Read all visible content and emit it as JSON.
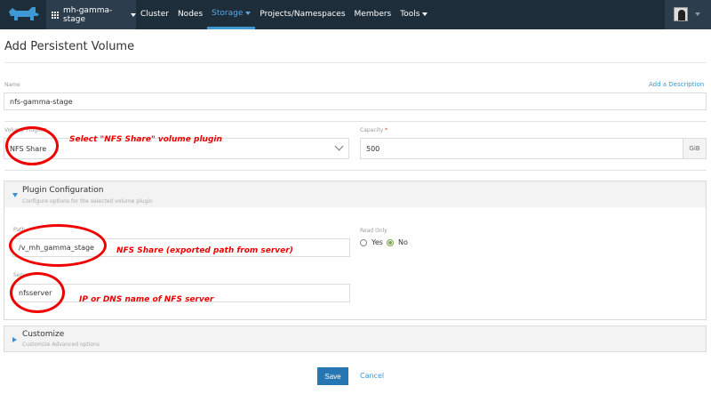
{
  "topbar": {
    "cluster": "mh-gamma-stage",
    "nav": [
      {
        "label": "Cluster",
        "caret": false
      },
      {
        "label": "Nodes",
        "caret": false
      },
      {
        "label": "Storage",
        "caret": true,
        "active": true
      },
      {
        "label": "Projects/Namespaces",
        "caret": false
      },
      {
        "label": "Members",
        "caret": false
      },
      {
        "label": "Tools",
        "caret": true
      }
    ]
  },
  "page": {
    "title": "Add Persistent Volume",
    "name_label": "Name",
    "add_description": "Add a Description",
    "name_value": "nfs-gamma-stage",
    "plugin_label": "Volume Plugin",
    "plugin_value": "NFS Share",
    "capacity_label": "Capacity",
    "capacity_value": "500",
    "capacity_unit": "GiB"
  },
  "plugin_config": {
    "title": "Plugin Configuration",
    "subtitle": "Configure options for the selected volume plugin",
    "path_label": "Path",
    "path_value": "/v_mh_gamma_stage",
    "server_label": "Server",
    "server_value": "nfsserver",
    "readonly_label": "Read Only",
    "yes": "Yes",
    "no": "No",
    "readonly_selected": "No"
  },
  "customize": {
    "title": "Customize",
    "subtitle": "Customize Advanced options"
  },
  "annotations": {
    "plugin": "Select \"NFS Share\" volume plugin",
    "path": "NFS Share (exported path from server)",
    "server": "IP or DNS name of NFS server"
  },
  "buttons": {
    "save": "Save",
    "cancel": "Cancel"
  },
  "colors": {
    "topbar": "#1e2d3a",
    "accent": "#3d98d3",
    "primary_button": "#2676b4",
    "annotation": "#ee0000"
  }
}
